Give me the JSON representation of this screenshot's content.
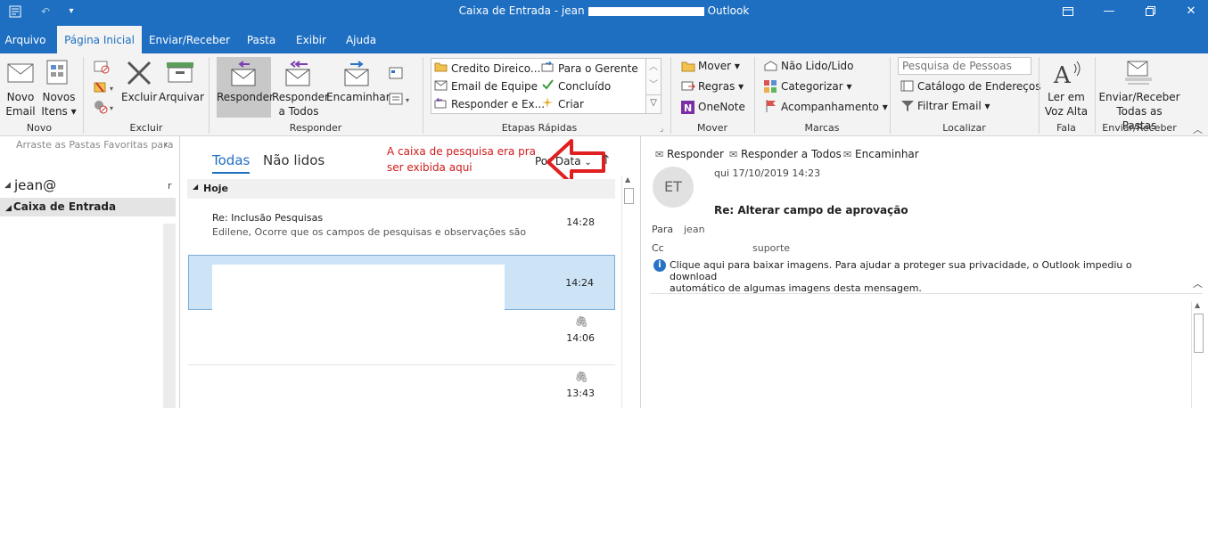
{
  "window": {
    "title_prefix": "Caixa de Entrada - jean",
    "title_suffix": "Outlook"
  },
  "tabs": [
    "Arquivo",
    "Página Inicial",
    "Enviar/Receber",
    "Pasta",
    "Exibir",
    "Ajuda"
  ],
  "active_tab": "Página Inicial",
  "ribbon": {
    "new_email_l1": "Novo",
    "new_email_l2": "Email",
    "new_items_l1": "Novos",
    "new_items_l2": "Itens ▾",
    "group_novo": "Novo",
    "excluir": "Excluir",
    "arquivar": "Arquivar",
    "group_excluir": "Excluir",
    "responder": "Responder",
    "responder_todos_l1": "Responder",
    "responder_todos_l2": "a Todos",
    "encaminhar": "Encaminhar",
    "group_responder": "Responder",
    "quick_steps": [
      "Credito Direico...",
      "Email de Equipe",
      "Responder e Ex...",
      "Para o Gerente",
      "Concluído",
      "Criar"
    ],
    "group_quick": "Etapas Rápidas",
    "mover": "Mover ▾",
    "regras": "Regras ▾",
    "onenote": "OneNote",
    "group_mover": "Mover",
    "nao_lido": "Não Lido/Lido",
    "categorizar": "Categorizar ▾",
    "acompanhamento": "Acompanhamento ▾",
    "group_marcas": "Marcas",
    "search_people_placeholder": "Pesquisa de Pessoas",
    "catalogo": "Catálogo de Endereços",
    "filtrar": "Filtrar Email ▾",
    "group_localizar": "Localizar",
    "ler_l1": "Ler em",
    "ler_l2": "Voz Alta",
    "group_fala": "Fala",
    "env_l1": "Enviar/Receber",
    "env_l2": "Todas as Pastas",
    "group_env": "Enviar/Receber"
  },
  "folders": {
    "favorites_hint": "Arraste as Pastas Favoritas para",
    "account": "jean@",
    "inbox": "Caixa de Entrada"
  },
  "list": {
    "filter_all": "Todas",
    "filter_unread": "Não lidos",
    "annotation_l1": "A caixa de pesquisa era pra",
    "annotation_l2": "ser exibida aqui",
    "sort": "Por Data",
    "group_today": "Hoje",
    "messages": [
      {
        "subject": "Re: Inclusão Pesquisas",
        "preview": "Edilene,  Ocorre que os campos de pesquisas e observações são",
        "time": "14:28"
      },
      {
        "subject": "",
        "preview": "",
        "time": "14:24"
      },
      {
        "subject": "",
        "preview": "",
        "time": "14:06"
      },
      {
        "subject": "",
        "preview": "",
        "time": "13:43"
      }
    ]
  },
  "reading": {
    "reply": "Responder",
    "reply_all": "Responder a Todos",
    "forward": "Encaminhar",
    "avatar": "ET",
    "date": "qui 17/10/2019 14:23",
    "subject": "Re: Alterar campo de aprovação",
    "to_label": "Para",
    "to_value": "jean",
    "cc_label": "Cc",
    "cc_value": "suporte",
    "info_line1": "Clique aqui para baixar imagens. Para ajudar a proteger sua privacidade, o Outlook impediu o download",
    "info_line2": "automático de algumas imagens desta mensagem."
  }
}
